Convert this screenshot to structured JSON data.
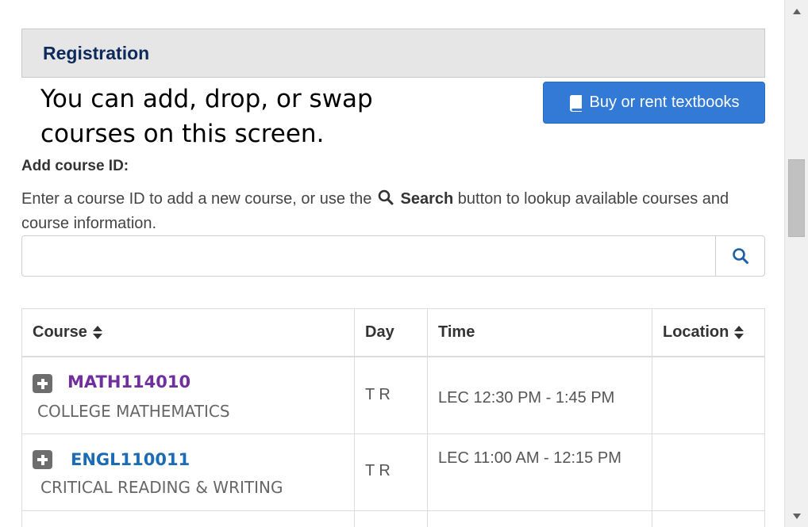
{
  "panel": {
    "title": "Registration"
  },
  "annotation": {
    "text": "You can add, drop, or swap courses on this screen."
  },
  "textbooks_button": {
    "label": "Buy or rent textbooks",
    "icon": "book-icon"
  },
  "add_course": {
    "label": "Add course ID:",
    "help_before": "Enter a course ID to add a new course, or use the",
    "help_search_word": "Search",
    "help_after": "button to lookup available courses and course information.",
    "input_value": "",
    "search_button_icon": "search-icon"
  },
  "table": {
    "headers": {
      "course": "Course",
      "day": "Day",
      "time": "Time",
      "location": "Location"
    },
    "rows": [
      {
        "course_id": "MATH114010",
        "course_title": "COLLEGE MATHEMATICS",
        "day": "T R",
        "time": "LEC 12:30 PM - 1:45 PM",
        "location": ""
      },
      {
        "course_id": "ENGL110011",
        "course_title": "CRITICAL READING & WRITING",
        "day": "T R",
        "time": "LEC 11:00 AM - 12:15 PM",
        "location": ""
      }
    ]
  },
  "colors": {
    "link_visited": "#6f2f9f",
    "link": "#1c6bb5",
    "primary_button": "#337ad6",
    "title": "#0d2a5c"
  }
}
